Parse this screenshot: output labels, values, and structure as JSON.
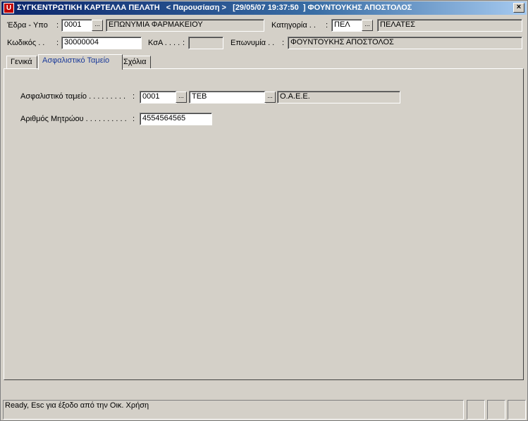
{
  "window": {
    "title": "ΣΥΓΚΕΝΤΡΩΤΙΚΗ ΚΑΡΤΕΛΛΑ ΠΕΛΑΤΗ   < Παρουσίαση >   [29/05/07 19:37:50  ] ΦΟΥΝΤΟΥΚΗΣ ΑΠΟΣΤΟΛΟΣ",
    "icon_letter": "U",
    "close_glyph": "×"
  },
  "header": {
    "edra_label": "Έδρα - Υπο",
    "edra_code": "0001",
    "edra_name": "ΕΠΩΝΥΜΙΑ ΦΑΡΜΑΚΕΙΟΥ",
    "category_label": "Κατηγορία . .",
    "category_code": "ΠΕΛ",
    "category_name": "ΠΕΛΑΤΕΣ",
    "code_label": "Κωδικός . .",
    "code_value": "30000004",
    "ksa_label": "ΚσΑ . . . .",
    "ksa_value": "",
    "name_label": "Επωνυμία . .",
    "name_value": "ΦΟΥΝΤΟΥΚΗΣ ΑΠΟΣΤΟΛΟΣ",
    "colon": ":",
    "ellipsis": "..."
  },
  "tabs": [
    {
      "label": "Γενικά"
    },
    {
      "label": "Ασφαλιστικό Ταμείο"
    },
    {
      "label": "Σχόλια"
    }
  ],
  "panel": {
    "fund_label": "Ασφαλιστικό ταμείο . . . . . . . . .",
    "fund_code": "0001",
    "fund_type": "ΤΕΒ",
    "fund_name": "Ο.Α.Ε.Ε.",
    "registry_label": "Αριθμός Μητρώου . . . . . . . . . .",
    "registry_value": "4554564565"
  },
  "status": {
    "text": "Ready, Esc για έξοδο από την Οικ. Χρήση"
  }
}
